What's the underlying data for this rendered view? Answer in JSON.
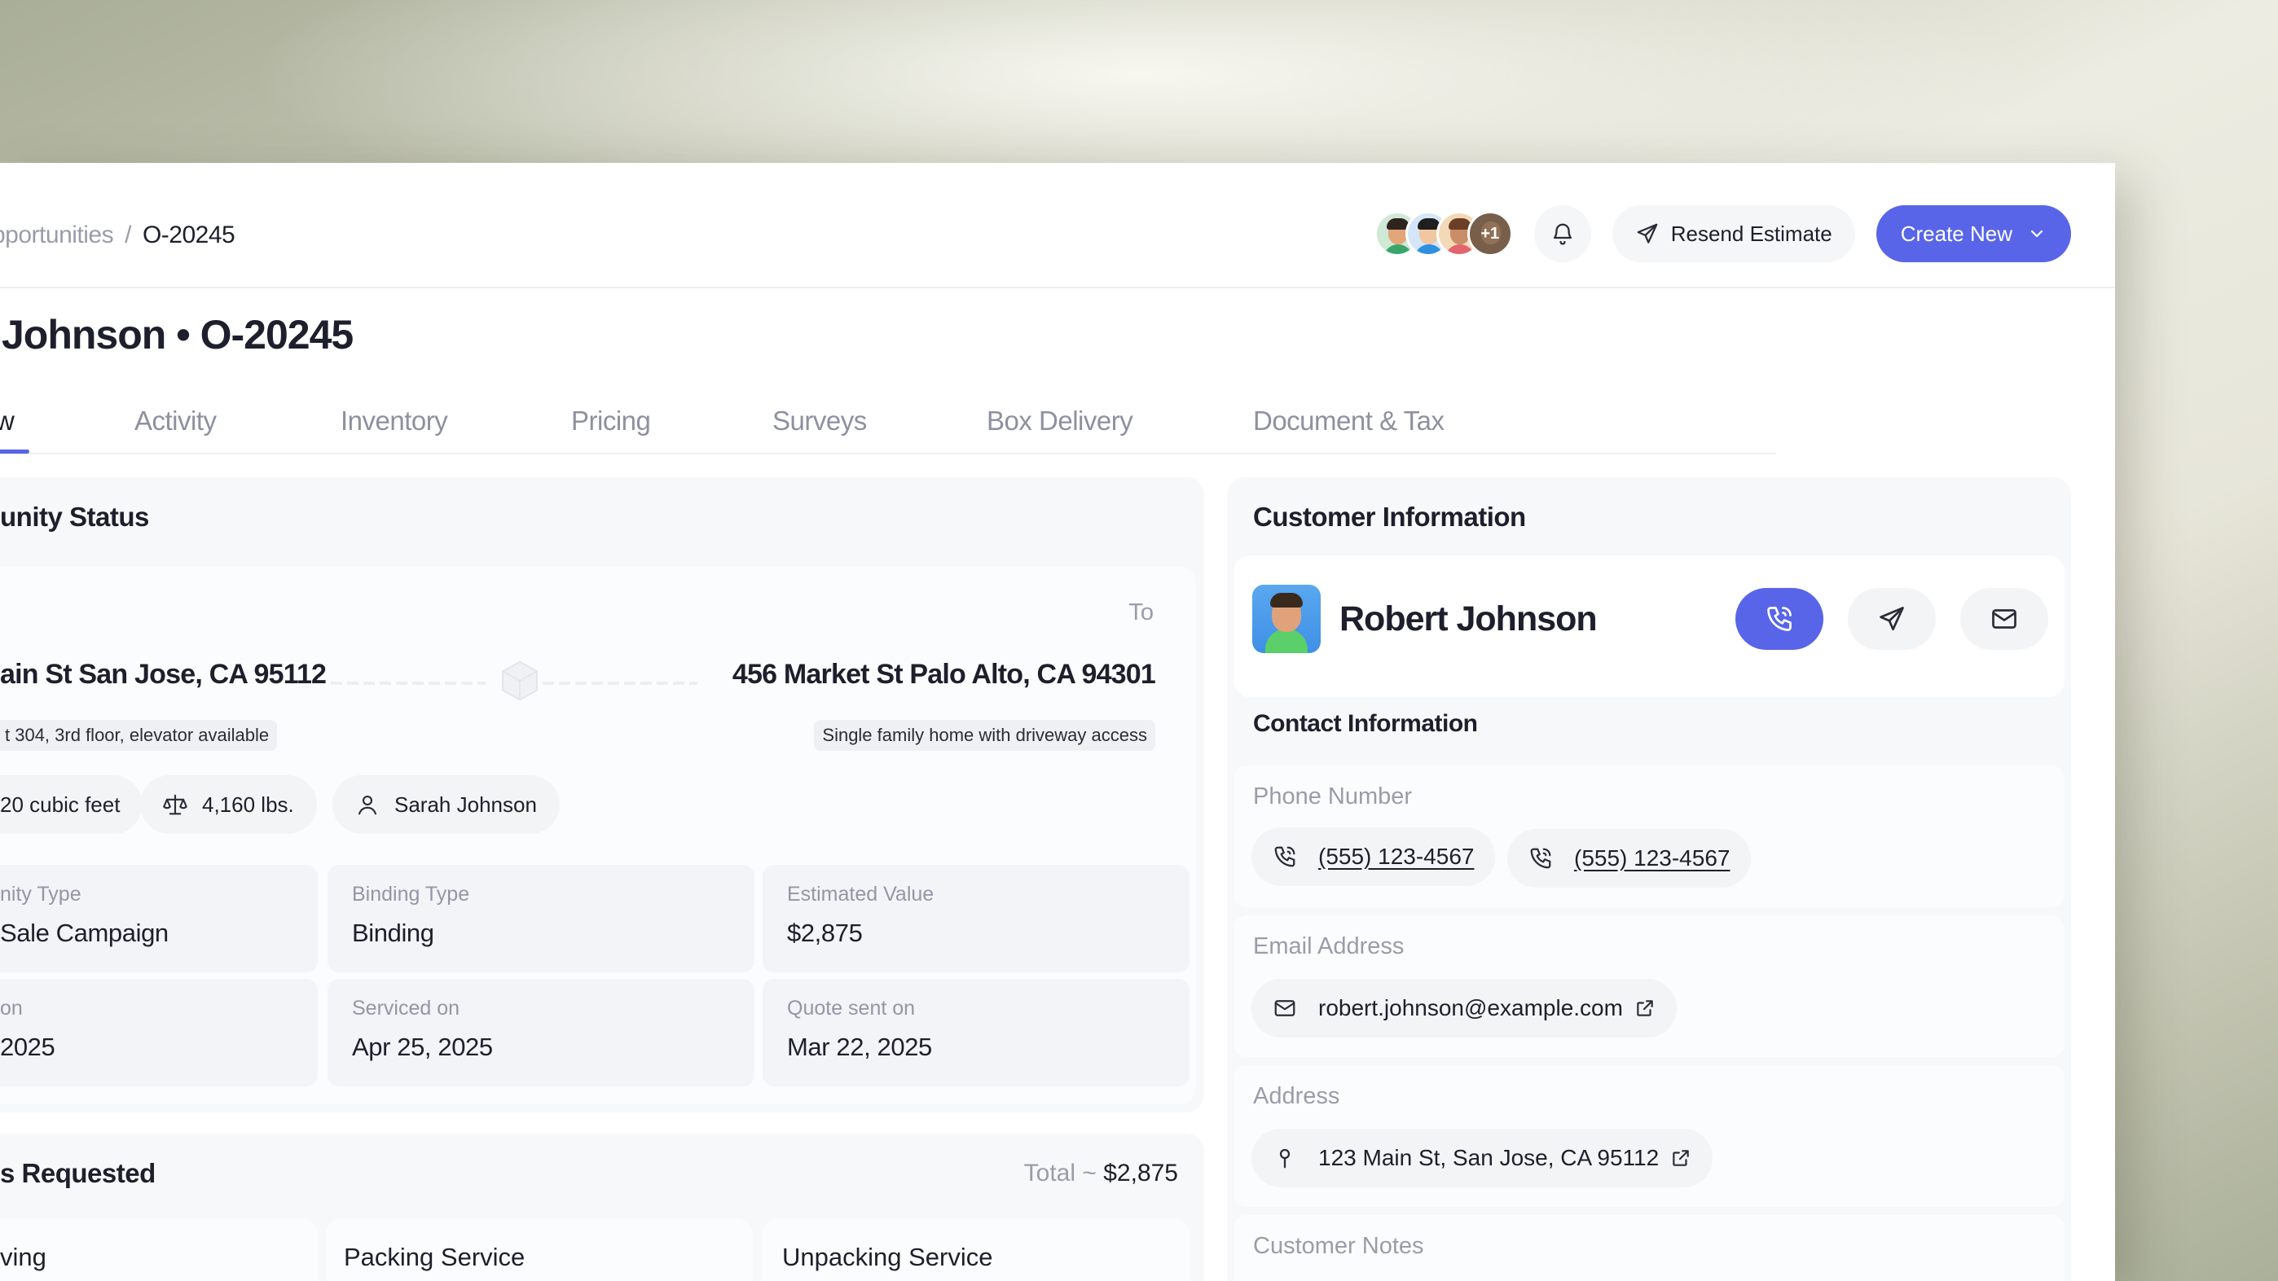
{
  "breadcrumb": {
    "parent": "pportunities",
    "separator": "/",
    "current": "O-20245"
  },
  "header": {
    "avatars": [
      {
        "name": "avatar-1",
        "skin": "#e3a57a",
        "hair": "#2f241d",
        "shirt": "#3aa56b"
      },
      {
        "name": "avatar-2",
        "skin": "#f0c7a0",
        "hair": "#1f1f1f",
        "shirt": "#2f8fe0"
      },
      {
        "name": "avatar-3",
        "skin": "#c98e67",
        "hair": "#6b3f25",
        "shirt": "#e2646e"
      }
    ],
    "more_count": "+1",
    "resend_label": "Resend Estimate",
    "create_label": "Create New",
    "accent": "#5865e8"
  },
  "page": {
    "title": "Johnson • O-20245"
  },
  "tabs": [
    "w",
    "Activity",
    "Inventory",
    "Pricing",
    "Surveys",
    "Box Delivery",
    "Document & Tax"
  ],
  "status": {
    "title": "unity Status",
    "to_label": "To",
    "from_address": "ain St San Jose, CA 95112",
    "to_address": "456 Market St Palo Alto, CA 94301",
    "from_note": "t 304, 3rd floor, elevator available",
    "to_note": "Single family home with driveway access",
    "volume": "20 cubic feet",
    "weight": "4,160 lbs.",
    "agent": "Sarah Johnson",
    "fields": [
      {
        "label": "nity Type",
        "value": "Sale Campaign"
      },
      {
        "label": "Binding Type",
        "value": "Binding"
      },
      {
        "label": "Estimated Value",
        "value": "$2,875"
      },
      {
        "label": "on",
        "value": "2025"
      },
      {
        "label": "Serviced on",
        "value": "Apr 25, 2025"
      },
      {
        "label": "Quote sent on",
        "value": "Mar 22, 2025"
      }
    ]
  },
  "services": {
    "title": "s Requested",
    "total_label": "Total ~",
    "total_value": "$2,875",
    "items": [
      "ving",
      "Packing Service",
      "Unpacking Service"
    ]
  },
  "customer": {
    "section_title": "Customer Information",
    "name": "Robert Johnson",
    "contact_title": "Contact Information",
    "phone_label": "Phone Number",
    "phones": [
      "(555) 123-4567",
      "(555) 123-4567"
    ],
    "email_label": "Email Address",
    "email": "robert.johnson@example.com",
    "address_label": "Address",
    "address": "123 Main St, San Jose, CA 95112",
    "notes_label": "Customer Notes"
  }
}
